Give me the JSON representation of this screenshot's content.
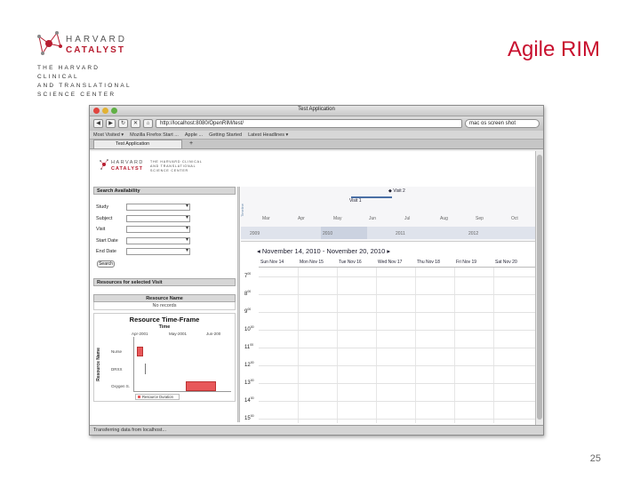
{
  "slide": {
    "title": "Agile RIM",
    "page_number": "25",
    "logo": {
      "line1": "HARVARD",
      "line2": "CATALYST",
      "tagline": [
        "THE HARVARD CLINICAL",
        "AND TRANSLATIONAL",
        "SCIENCE CENTER"
      ]
    }
  },
  "browser": {
    "window_title": "Test Application",
    "url": "http://localhost:8080/OpenRIM/test/",
    "search_value": "mac os screen shot",
    "bookmarks": [
      "Most Visited ▾",
      "Mozilla Firefox Start ...",
      "Apple ...",
      "Getting Started",
      "Latest Headlines ▾"
    ],
    "tab_label": "Test Application",
    "status": "Transferring data from localhost..."
  },
  "app": {
    "search_panel": {
      "heading": "Search Availability",
      "fields": [
        "Study",
        "Subject",
        "Visit",
        "Start Date",
        "End Date"
      ],
      "button": "Search"
    },
    "resources_heading": "Resources for selected Visit",
    "resource_table": {
      "header": "Resource Name",
      "empty": "No records"
    },
    "resource_timeframe": {
      "title": "Resource Time-Frame",
      "axis_title": "Time",
      "ticks": [
        "Apr-2001",
        "May-2001",
        "Jun-200"
      ],
      "y_title": "Resource Name",
      "rows": [
        "Nurse",
        "DRXX",
        "Oxygen S."
      ],
      "legend": "Resource Duration",
      "bars_color": "#e8585a"
    },
    "timeline": {
      "side_label": "Timeline",
      "events": [
        "Visit 2",
        "Visit 1"
      ],
      "months": [
        "Mar",
        "Apr",
        "May",
        "Jun",
        "Jul",
        "Aug",
        "Sep",
        "Oct"
      ],
      "years": [
        "2009",
        "2010",
        "2011",
        "2012"
      ]
    },
    "calendar": {
      "range": "November 14, 2010 - November 20, 2010",
      "days": [
        "Sun Nov 14",
        "Mon Nov 15",
        "Tue Nov 16",
        "Wed Nov 17",
        "Thu Nov 18",
        "Fri Nov 19",
        "Sat Nov 20"
      ],
      "hours": [
        "7",
        "8",
        "9",
        "10",
        "11",
        "12",
        "13",
        "14",
        "15"
      ],
      "minutes": "00"
    }
  }
}
